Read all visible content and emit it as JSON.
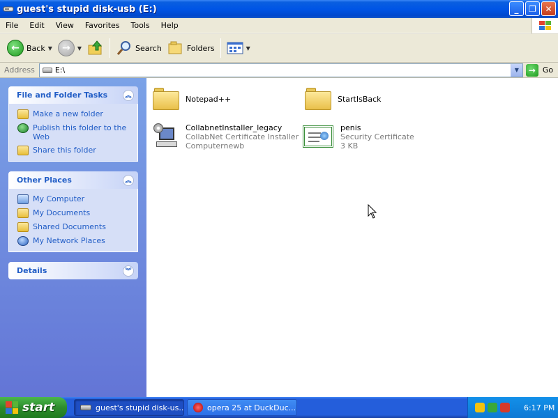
{
  "window": {
    "title": "guest's stupid disk-usb (E:)",
    "buttons": {
      "minimize": "_",
      "maximize": "❐",
      "close": "✕"
    }
  },
  "menu": [
    "File",
    "Edit",
    "View",
    "Favorites",
    "Tools",
    "Help"
  ],
  "toolbar": {
    "back_label": "Back",
    "search_label": "Search",
    "folders_label": "Folders"
  },
  "address": {
    "label": "Address",
    "value": "E:\\",
    "go_label": "Go"
  },
  "sidebar": {
    "file_tasks": {
      "title": "File and Folder Tasks",
      "items": [
        "Make a new folder",
        "Publish this folder to the Web",
        "Share this folder"
      ]
    },
    "other_places": {
      "title": "Other Places",
      "items": [
        "My Computer",
        "My Documents",
        "Shared Documents",
        "My Network Places"
      ]
    },
    "details": {
      "title": "Details"
    }
  },
  "files": [
    {
      "name": "Notepad++",
      "type": "folder",
      "line2": "",
      "line3": ""
    },
    {
      "name": "StartIsBack",
      "type": "folder",
      "line2": "",
      "line3": ""
    },
    {
      "name": "CollabnetInstaller_legacy",
      "type": "installer",
      "line2": "CollabNet Certificate Installer",
      "line3": "Computernewb"
    },
    {
      "name": "penis",
      "type": "certificate",
      "line2": "Security Certificate",
      "line3": "3 KB"
    }
  ],
  "taskbar": {
    "start_label": "start",
    "tasks": [
      {
        "label": "guest's stupid disk-us...",
        "active": true
      },
      {
        "label": "opera 25 at DuckDuc...",
        "active": false
      }
    ],
    "clock": "6:17 PM"
  },
  "colors": {
    "titlebar": "#0055e5",
    "sidebar_link": "#215dc6",
    "start_green": "#2d8c2d"
  }
}
